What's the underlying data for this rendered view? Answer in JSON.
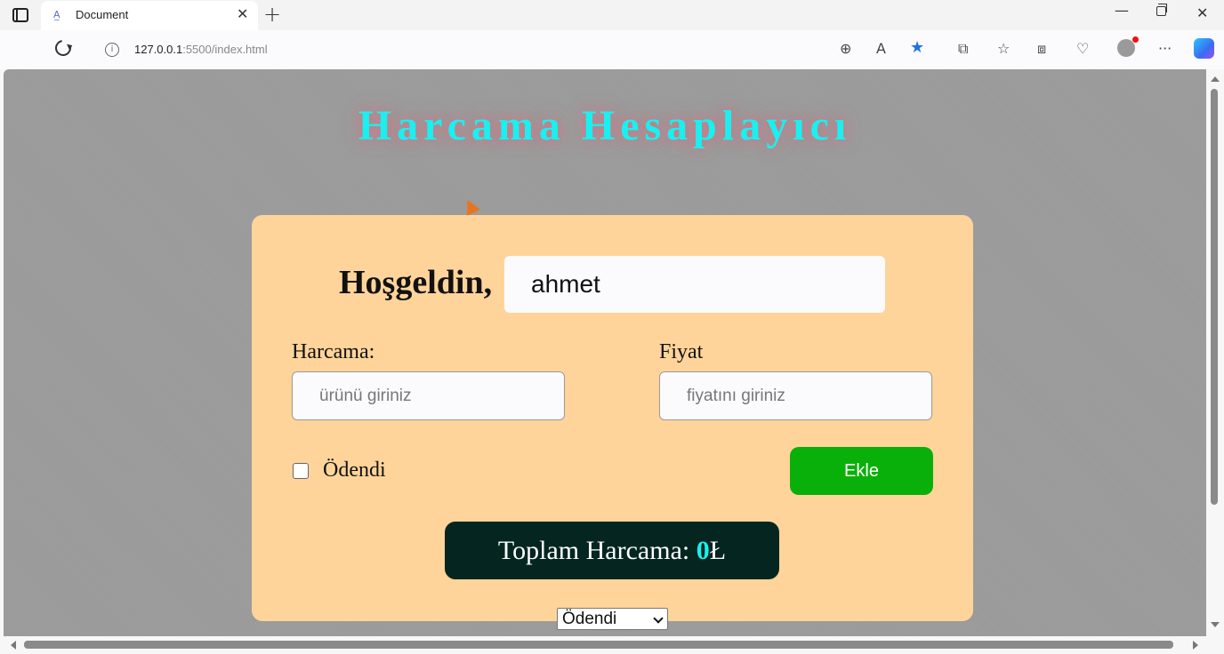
{
  "browser": {
    "tab_title": "Document",
    "favicon": "A̲",
    "url_host": "127.0.0.1",
    "url_path": ":5500/index.html",
    "close_glyph": "✕",
    "new_tab_glyph": "+",
    "min_glyph": "—",
    "close_win_glyph": "✕",
    "icons": {
      "zoom": "⊕",
      "read_aloud": "A",
      "favorite": "★",
      "split": "⧉",
      "favorites": "☆",
      "collections": "⧈",
      "health": "♡",
      "more": "···"
    }
  },
  "page": {
    "title": "Harcama Hesaplayıcı",
    "welcome": "Hoşgeldin,",
    "name_value": "ahmet",
    "expense_label": "Harcama:",
    "expense_placeholder": "ürünü giriniz",
    "price_label": "Fiyat",
    "price_placeholder": "fiyatını giriniz",
    "paid_label": "Ödendi",
    "add_button": "Ekle",
    "total_label": "Toplam Harcama: ",
    "total_value": "0",
    "currency": "Ł",
    "filter_selected": "Ödendi"
  },
  "colors": {
    "title": "#19f0f0",
    "card": "#ffd49a",
    "add_button": "#0ab00a",
    "total_box": "#052620",
    "background": "#9a9a9a"
  }
}
